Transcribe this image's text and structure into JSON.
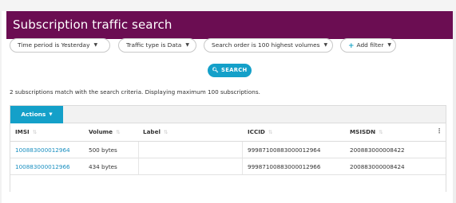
{
  "header": {
    "title": "Subscription traffic search"
  },
  "filters": [
    {
      "label": "Time period is Yesterday"
    },
    {
      "label": "Traffic type is Data"
    },
    {
      "label": "Search order is 100 highest volumes"
    },
    {
      "label": "Add filter"
    }
  ],
  "search": {
    "label": "SEARCH"
  },
  "result_text": "2 subscriptions match with the search criteria. Displaying maximum 100 subscriptions.",
  "actions": {
    "label": "Actions"
  },
  "table": {
    "columns": [
      "IMSI",
      "Volume",
      "Label",
      "ICCID",
      "MSISDN"
    ],
    "rows": [
      {
        "imsi": "100883000012964",
        "volume": "500 bytes",
        "label": "",
        "iccid": "99987100883000012964",
        "msisdn": "200883000008422"
      },
      {
        "imsi": "100883000012966",
        "volume": "434 bytes",
        "label": "",
        "iccid": "99987100883000012966",
        "msisdn": "200883000008424"
      }
    ]
  },
  "colors": {
    "header": "#6b0d52",
    "accent": "#14a0c9",
    "link": "#1a8fc0"
  }
}
